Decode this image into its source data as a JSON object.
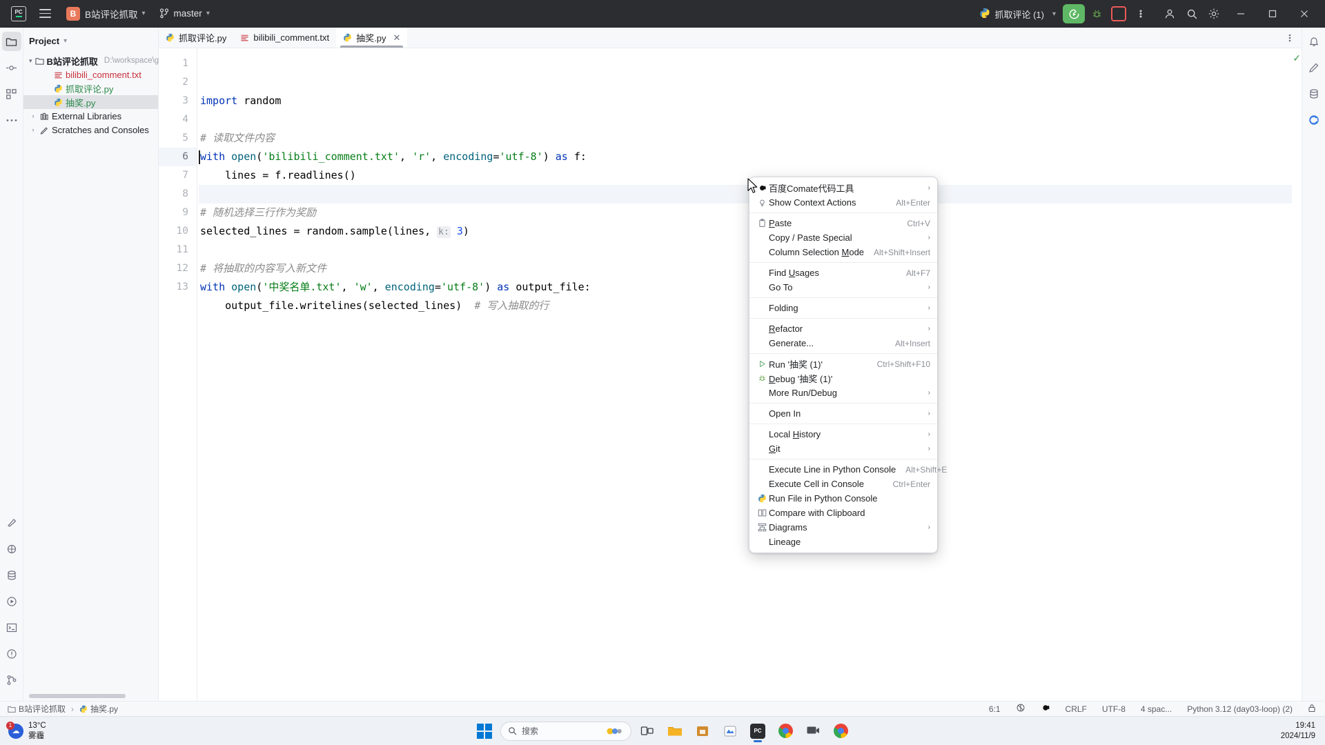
{
  "titlebar": {
    "logo_text": "PC",
    "project_badge": "B",
    "project_name": "B站评论抓取",
    "branch": "master",
    "run_config": "抓取评论 (1)",
    "icons": {
      "menu": "hamburger-icon",
      "branch": "git-branch-icon",
      "run": "run-icon",
      "debug": "debug-icon",
      "stop": "stop-icon",
      "more": "more-vertical-icon",
      "account": "user-account-icon",
      "search": "search-icon",
      "settings": "settings-gear-icon",
      "minimize": "minimize-icon",
      "maximize": "maximize-icon",
      "close": "close-icon"
    }
  },
  "sidebar": {
    "title": "Project",
    "tree": [
      {
        "label": "B站评论抓取",
        "path": "D:\\workspace\\githu",
        "kind": "folder",
        "expanded": true,
        "indent": 0,
        "selected": false
      },
      {
        "label": "bilibili_comment.txt",
        "path": "",
        "kind": "txt",
        "indent": 1,
        "selected": false
      },
      {
        "label": "抓取评论.py",
        "path": "",
        "kind": "py",
        "indent": 1,
        "selected": false
      },
      {
        "label": "抽奖.py",
        "path": "",
        "kind": "py",
        "indent": 1,
        "selected": true
      },
      {
        "label": "External Libraries",
        "path": "",
        "kind": "lib",
        "expanded": false,
        "indent": 0,
        "selected": false
      },
      {
        "label": "Scratches and Consoles",
        "path": "",
        "kind": "scratch",
        "expanded": false,
        "indent": 0,
        "selected": false
      }
    ]
  },
  "tabs": [
    {
      "label": "抓取评论.py",
      "kind": "py",
      "active": false,
      "closable": false
    },
    {
      "label": "bilibili_comment.txt",
      "kind": "txt",
      "active": false,
      "closable": false
    },
    {
      "label": "抽奖.py",
      "kind": "py",
      "active": true,
      "closable": true
    }
  ],
  "editor": {
    "line_numbers": [
      "1",
      "2",
      "3",
      "4",
      "5",
      "6",
      "7",
      "8",
      "9",
      "10",
      "11",
      "12",
      "13"
    ],
    "current_line": 6,
    "lines": [
      {
        "n": 1,
        "tokens": [
          {
            "t": "import",
            "c": "kw"
          },
          {
            "t": " random",
            "c": "ident"
          }
        ]
      },
      {
        "n": 2,
        "tokens": []
      },
      {
        "n": 3,
        "tokens": [
          {
            "t": "# 读取文件内容",
            "c": "cmt"
          }
        ]
      },
      {
        "n": 4,
        "tokens": [
          {
            "t": "with",
            "c": "kw"
          },
          {
            "t": " ",
            "c": "ident"
          },
          {
            "t": "open",
            "c": "fn"
          },
          {
            "t": "(",
            "c": "ident"
          },
          {
            "t": "'bilibili_comment.txt'",
            "c": "str"
          },
          {
            "t": ", ",
            "c": "ident"
          },
          {
            "t": "'r'",
            "c": "str"
          },
          {
            "t": ", ",
            "c": "ident"
          },
          {
            "t": "encoding",
            "c": "fn"
          },
          {
            "t": "=",
            "c": "ident"
          },
          {
            "t": "'utf-8'",
            "c": "str"
          },
          {
            "t": ") ",
            "c": "ident"
          },
          {
            "t": "as",
            "c": "kw"
          },
          {
            "t": " f:",
            "c": "ident"
          }
        ]
      },
      {
        "n": 5,
        "tokens": [
          {
            "t": "    lines = f.readlines()",
            "c": "ident"
          }
        ]
      },
      {
        "n": 6,
        "tokens": []
      },
      {
        "n": 7,
        "tokens": [
          {
            "t": "# 随机选择三行作为奖励",
            "c": "cmt"
          }
        ]
      },
      {
        "n": 8,
        "tokens": [
          {
            "t": "selected_lines = random.sample(lines, ",
            "c": "ident"
          },
          {
            "t": "k:",
            "c": "hint"
          },
          {
            "t": " ",
            "c": "ident"
          },
          {
            "t": "3",
            "c": "num"
          },
          {
            "t": ")",
            "c": "ident"
          }
        ]
      },
      {
        "n": 9,
        "tokens": []
      },
      {
        "n": 10,
        "tokens": [
          {
            "t": "# 将抽取的内容写入新文件",
            "c": "cmt"
          }
        ]
      },
      {
        "n": 11,
        "tokens": [
          {
            "t": "with",
            "c": "kw"
          },
          {
            "t": " ",
            "c": "ident"
          },
          {
            "t": "open",
            "c": "fn"
          },
          {
            "t": "(",
            "c": "ident"
          },
          {
            "t": "'中奖名单.txt'",
            "c": "str"
          },
          {
            "t": ", ",
            "c": "ident"
          },
          {
            "t": "'w'",
            "c": "str"
          },
          {
            "t": ", ",
            "c": "ident"
          },
          {
            "t": "encoding",
            "c": "fn"
          },
          {
            "t": "=",
            "c": "ident"
          },
          {
            "t": "'utf-8'",
            "c": "str"
          },
          {
            "t": ") ",
            "c": "ident"
          },
          {
            "t": "as",
            "c": "kw"
          },
          {
            "t": " output_file:",
            "c": "ident"
          }
        ]
      },
      {
        "n": 12,
        "tokens": [
          {
            "t": "    output_file.writelines(selected_lines)  ",
            "c": "ident"
          },
          {
            "t": "# 写入抽取的行",
            "c": "cmt"
          }
        ]
      },
      {
        "n": 13,
        "tokens": []
      }
    ]
  },
  "context_menu": {
    "items": [
      {
        "label": "百度Comate代码工具",
        "icon": "comate-icon",
        "shortcut": "",
        "submenu": true
      },
      {
        "label": "Show Context Actions",
        "icon": "lightbulb-icon",
        "shortcut": "Alt+Enter",
        "submenu": false
      },
      {
        "sep": true
      },
      {
        "label": "Paste",
        "icon": "clipboard-icon",
        "shortcut": "Ctrl+V",
        "submenu": false,
        "mnemonic": "P"
      },
      {
        "label": "Copy / Paste Special",
        "icon": "",
        "shortcut": "",
        "submenu": true
      },
      {
        "label": "Column Selection Mode",
        "icon": "",
        "shortcut": "Alt+Shift+Insert",
        "submenu": false,
        "mnemonic": "M"
      },
      {
        "sep": true
      },
      {
        "label": "Find Usages",
        "icon": "",
        "shortcut": "Alt+F7",
        "submenu": false,
        "mnemonic": "U"
      },
      {
        "label": "Go To",
        "icon": "",
        "shortcut": "",
        "submenu": true
      },
      {
        "sep": true
      },
      {
        "label": "Folding",
        "icon": "",
        "shortcut": "",
        "submenu": true
      },
      {
        "sep": true
      },
      {
        "label": "Refactor",
        "icon": "",
        "shortcut": "",
        "submenu": true,
        "mnemonic": "R"
      },
      {
        "label": "Generate...",
        "icon": "",
        "shortcut": "Alt+Insert",
        "submenu": false
      },
      {
        "sep": true
      },
      {
        "label": "Run '抽奖 (1)'",
        "icon": "run-green-icon",
        "shortcut": "Ctrl+Shift+F10",
        "submenu": false
      },
      {
        "label": "Debug '抽奖 (1)'",
        "icon": "debug-icon",
        "shortcut": "",
        "submenu": false,
        "mnemonic": "D"
      },
      {
        "label": "More Run/Debug",
        "icon": "",
        "shortcut": "",
        "submenu": true
      },
      {
        "sep": true
      },
      {
        "label": "Open In",
        "icon": "",
        "shortcut": "",
        "submenu": true
      },
      {
        "sep": true
      },
      {
        "label": "Local History",
        "icon": "",
        "shortcut": "",
        "submenu": true,
        "mnemonic": "H"
      },
      {
        "label": "Git",
        "icon": "",
        "shortcut": "",
        "submenu": true,
        "mnemonic": "G"
      },
      {
        "sep": true
      },
      {
        "label": "Execute Line in Python Console",
        "icon": "",
        "shortcut": "Alt+Shift+E",
        "submenu": false
      },
      {
        "label": "Execute Cell in Console",
        "icon": "",
        "shortcut": "Ctrl+Enter",
        "submenu": false
      },
      {
        "label": "Run File in Python Console",
        "icon": "python-icon",
        "shortcut": "",
        "submenu": false
      },
      {
        "label": "Compare with Clipboard",
        "icon": "compare-icon",
        "shortcut": "",
        "submenu": false
      },
      {
        "label": "Diagrams",
        "icon": "diagram-icon",
        "shortcut": "",
        "submenu": true
      },
      {
        "label": "Lineage",
        "icon": "",
        "shortcut": "",
        "submenu": false
      }
    ]
  },
  "statusbar": {
    "breadcrumb_project": "B站评论抓取",
    "breadcrumb_file": "抽奖.py",
    "caret": "6:1",
    "line_sep": "CRLF",
    "encoding": "UTF-8",
    "indent": "4 spac...",
    "interpreter": "Python 3.12 (day03-loop) (2)"
  },
  "taskbar": {
    "weather_temp": "13°C",
    "weather_desc": "雾霾",
    "weather_badge": "1",
    "search_placeholder": "搜索",
    "clock_time": "19:41",
    "clock_date": "2024/11/9",
    "apps": [
      {
        "name": "widgets-icon"
      },
      {
        "name": "file-explorer-icon"
      },
      {
        "name": "store-icon"
      },
      {
        "name": "editor-icon"
      },
      {
        "name": "pycharm-icon",
        "running": true
      },
      {
        "name": "chrome-icon"
      },
      {
        "name": "screen-icon"
      },
      {
        "name": "chrome2-icon"
      }
    ]
  },
  "colors": {
    "titlebar_bg": "#2b2d30",
    "accent_green": "#5fb865",
    "project_badge": "#e8795a",
    "string_green": "#067d17",
    "keyword_blue": "#0033b3"
  }
}
